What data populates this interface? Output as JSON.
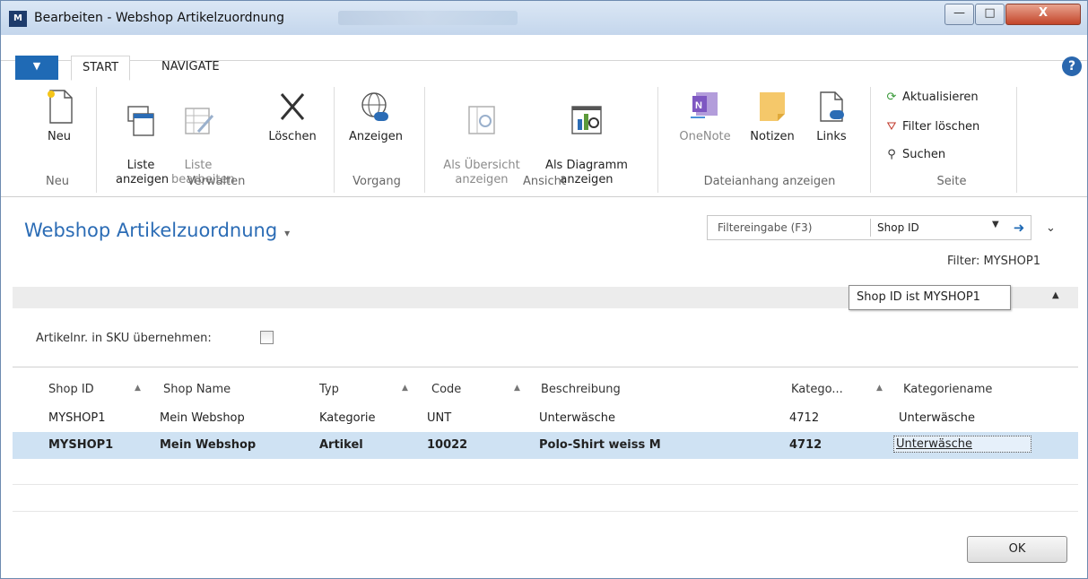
{
  "window": {
    "title": "Bearbeiten - Webshop Artikelzuordnung",
    "app_icon": "nav-logo",
    "controls": {
      "minimize": "—",
      "maximize": "□",
      "close": "X"
    }
  },
  "ribbon": {
    "file_menu_glyph": "▼",
    "tabs": [
      {
        "label": "START"
      },
      {
        "label": "NAVIGATE"
      }
    ],
    "help_glyph": "?",
    "buttons": {
      "neu": "Neu",
      "liste_anzeigen": "Liste\nanzeigen",
      "liste_bearbeiten": "Liste\nbearbeiten",
      "loeschen": "Löschen",
      "anzeigen": "Anzeigen",
      "als_uebersicht": "Als Übersicht\nanzeigen",
      "als_diagramm": "Als Diagramm\nanzeigen",
      "onenote": "OneNote",
      "notizen": "Notizen",
      "links": "Links",
      "aktualisieren": "Aktualisieren",
      "filter_loeschen": "Filter löschen",
      "suchen": "Suchen"
    },
    "groups": {
      "neu": "Neu",
      "verwalten": "Verwalten",
      "vorgang": "Vorgang",
      "ansicht": "Ansicht",
      "dateianhang": "Dateianhang anzeigen",
      "seite": "Seite"
    }
  },
  "page": {
    "title": "Webshop Artikelzuordnung",
    "title_caret": "▾",
    "filter": {
      "placeholder": "Filtereingabe (F3)",
      "field": "Shop ID",
      "active_filter": "Filter: MYSHOP1"
    },
    "tooltip": "Shop ID ist MYSHOP1",
    "sku_label": "Artikelnr. in SKU übernehmen:",
    "sku_checked": false
  },
  "grid": {
    "columns": [
      "Shop ID",
      "Shop Name",
      "Typ",
      "Code",
      "Beschreibung",
      "Katego...",
      "Kategoriename"
    ],
    "rows": [
      {
        "shop_id": "MYSHOP1",
        "shop_name": "Mein Webshop",
        "typ": "Kategorie",
        "code": "UNT",
        "beschreibung": "Unterwäsche",
        "kategorie": "4712",
        "kategoriename": "Unterwäsche"
      },
      {
        "shop_id": "MYSHOP1",
        "shop_name": "Mein Webshop",
        "typ": "Artikel",
        "code": "10022",
        "beschreibung": "Polo-Shirt weiss M",
        "kategorie": "4712",
        "kategoriename": "Unterwäsche"
      }
    ],
    "selected_row": 2
  },
  "footer": {
    "ok": "OK"
  },
  "colors": {
    "accent": "#2b6cb5",
    "selected_row": "#cfe2f3",
    "file_tab": "#1f6ab5"
  }
}
